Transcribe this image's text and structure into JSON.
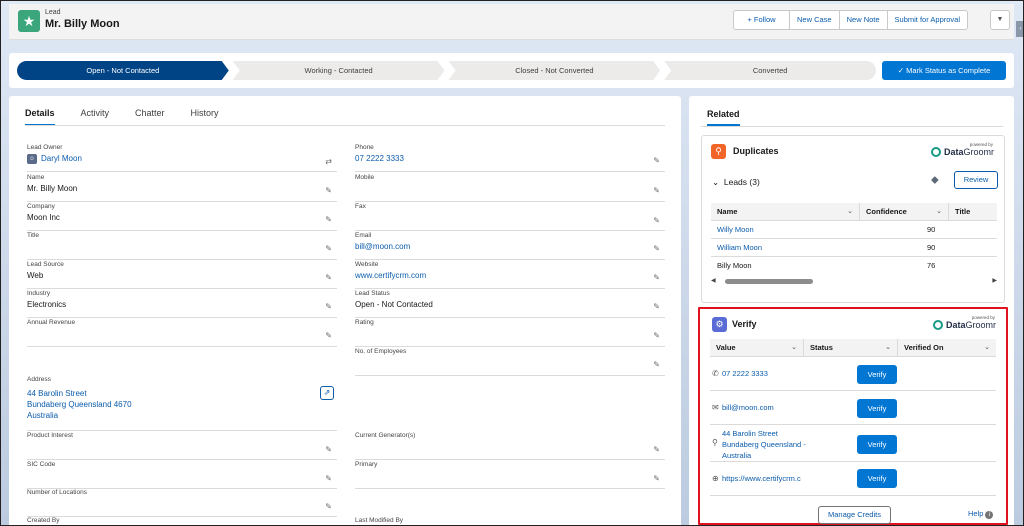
{
  "header": {
    "record_type": "Lead",
    "record_name": "Mr. Billy Moon",
    "actions": [
      "+ Follow",
      "New Case",
      "New Note",
      "Submit for Approval"
    ],
    "more_icon": "chevron-down-icon"
  },
  "path": {
    "stages": [
      "Open - Not Contacted",
      "Working - Contacted",
      "Closed - Not Converted",
      "Converted"
    ],
    "current_index": 0,
    "mark_button": "✓ Mark Status as Complete"
  },
  "tabs": [
    "Details",
    "Activity",
    "Chatter",
    "History"
  ],
  "details": {
    "lead_owner": {
      "label": "Lead Owner",
      "value": "Daryl Moon"
    },
    "name": {
      "label": "Name",
      "value": "Mr. Billy Moon"
    },
    "company": {
      "label": "Company",
      "value": "Moon Inc"
    },
    "title": {
      "label": "Title",
      "value": ""
    },
    "lead_source": {
      "label": "Lead Source",
      "value": "Web"
    },
    "industry": {
      "label": "Industry",
      "value": "Electronics"
    },
    "annual_revenue": {
      "label": "Annual Revenue",
      "value": ""
    },
    "address": {
      "label": "Address",
      "line1": "44 Barolin Street",
      "line2": "Bundaberg Queensland 4670",
      "line3": "Australia"
    },
    "product_interest": {
      "label": "Product Interest",
      "value": ""
    },
    "sic_code": {
      "label": "SIC Code",
      "value": ""
    },
    "number_of_locations": {
      "label": "Number of Locations",
      "value": ""
    },
    "created_by": {
      "label": "Created By",
      "value": ""
    },
    "phone": {
      "label": "Phone",
      "value": "07 2222 3333"
    },
    "mobile": {
      "label": "Mobile",
      "value": ""
    },
    "fax": {
      "label": "Fax",
      "value": ""
    },
    "email": {
      "label": "Email",
      "value": "bill@moon.com"
    },
    "website": {
      "label": "Website",
      "value": "www.certifycrm.com"
    },
    "lead_status": {
      "label": "Lead Status",
      "value": "Open - Not Contacted"
    },
    "rating": {
      "label": "Rating",
      "value": ""
    },
    "employees": {
      "label": "No. of Employees",
      "value": ""
    },
    "current_generators": {
      "label": "Current Generator(s)",
      "value": ""
    },
    "primary": {
      "label": "Primary",
      "value": ""
    },
    "last_modified_by": {
      "label": "Last Modified By",
      "value": ""
    }
  },
  "related": {
    "tab": "Related",
    "duplicates": {
      "title": "Duplicates",
      "powered_by": "powered by",
      "brand_data": "Data",
      "brand_groomr": "Groomr",
      "leads_toggle": "Leads (3)",
      "review": "Review",
      "columns": [
        "Name",
        "Confidence",
        "Title"
      ],
      "rows": [
        {
          "name": "Willy Moon",
          "confidence": "90",
          "title": ""
        },
        {
          "name": "William Moon",
          "confidence": "90",
          "title": ""
        },
        {
          "name": "Billy Moon",
          "confidence": "76",
          "title": ""
        }
      ]
    },
    "verify": {
      "title": "Verify",
      "columns": [
        "Value",
        "Status",
        "Verified On"
      ],
      "rows": [
        {
          "value": "07 2222 3333",
          "button": "Verify"
        },
        {
          "value": "bill@moon.com",
          "button": "Verify"
        },
        {
          "value_line1": "44 Barolin Street",
          "value_line2": "Bundaberg Queensland -",
          "value_line3": "Australia",
          "button": "Verify"
        },
        {
          "value": "https://www.certifycrm.c",
          "button": "Verify"
        }
      ],
      "manage_credits": "Manage Credits",
      "help": "Help"
    }
  },
  "colors": {
    "brand_blue": "#0176d3",
    "path_current": "#014486",
    "lead_icon": "#3ba57b",
    "duplicates_icon": "#f26528",
    "verify_icon": "#5a6bd5",
    "highlight_border": "#e0121f"
  }
}
